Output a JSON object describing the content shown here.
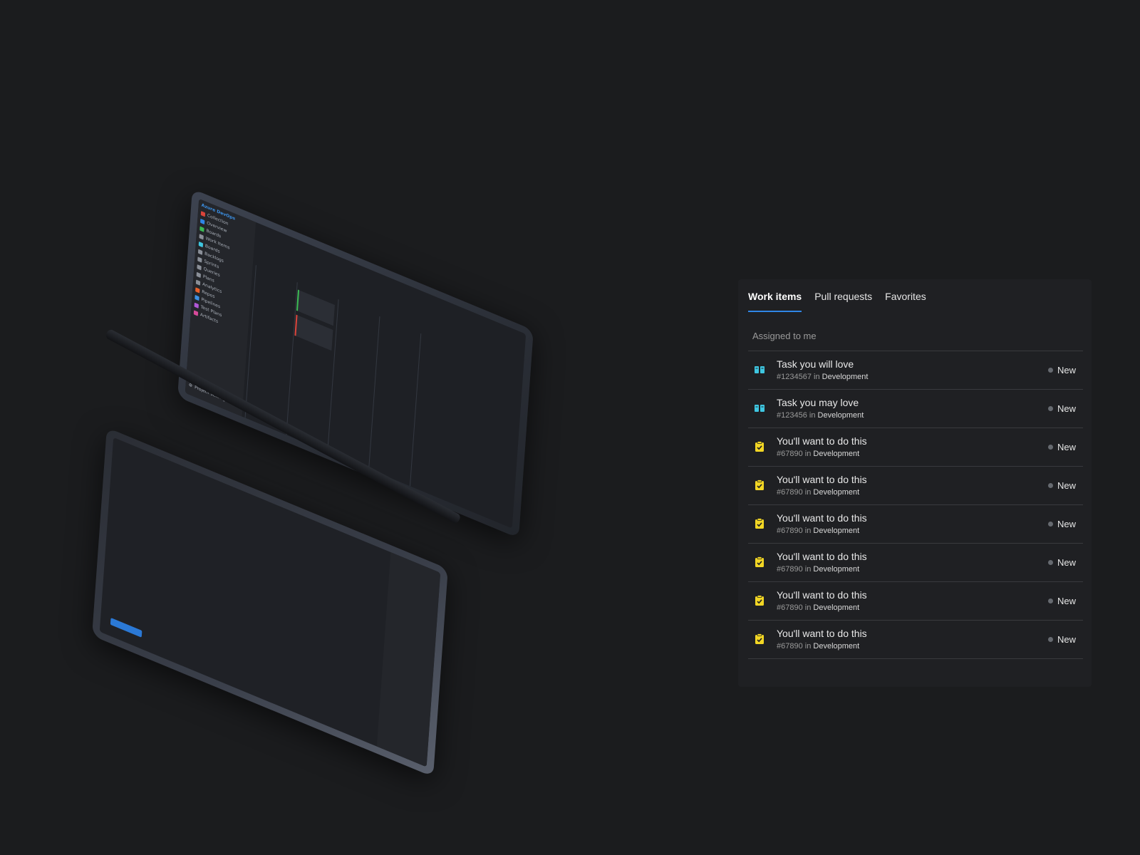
{
  "colors": {
    "background": "#1b1c1e",
    "panel": "#1f2023",
    "accent": "#2f86e6",
    "story_icon": "#3ec6e0",
    "task_icon": "#f2d624",
    "state_new": "#666a70"
  },
  "tabs": [
    {
      "label": "Work items",
      "active": true
    },
    {
      "label": "Pull requests",
      "active": false
    },
    {
      "label": "Favorites",
      "active": false
    }
  ],
  "section_label": "Assigned to me",
  "work_items": [
    {
      "icon": "book-icon",
      "title": "Task you will love",
      "id": "#1234567",
      "in_word": "in",
      "project": "Development",
      "state": "New"
    },
    {
      "icon": "book-icon",
      "title": "Task you may love",
      "id": "#123456",
      "in_word": "in",
      "project": "Development",
      "state": "New"
    },
    {
      "icon": "clipboard-check-icon",
      "title": "You'll want to do this",
      "id": "#67890",
      "in_word": "in",
      "project": "Development",
      "state": "New"
    },
    {
      "icon": "clipboard-check-icon",
      "title": "You'll want to do this",
      "id": "#67890",
      "in_word": "in",
      "project": "Development",
      "state": "New"
    },
    {
      "icon": "clipboard-check-icon",
      "title": "You'll want to do this",
      "id": "#67890",
      "in_word": "in",
      "project": "Development",
      "state": "New"
    },
    {
      "icon": "clipboard-check-icon",
      "title": "You'll want to do this",
      "id": "#67890",
      "in_word": "in",
      "project": "Development",
      "state": "New"
    },
    {
      "icon": "clipboard-check-icon",
      "title": "You'll want to do this",
      "id": "#67890",
      "in_word": "in",
      "project": "Development",
      "state": "New"
    },
    {
      "icon": "clipboard-check-icon",
      "title": "You'll want to do this",
      "id": "#67890",
      "in_word": "in",
      "project": "Development",
      "state": "New"
    }
  ],
  "device": {
    "brand": "Azure DevOps",
    "org": "Collection",
    "nav": [
      "Overview",
      "Boards",
      "Work Items",
      "Boards",
      "Backlogs",
      "Sprints",
      "Queries",
      "Plans",
      "Analytics",
      "Repos",
      "Pipelines",
      "Test Plans",
      "Artifacts"
    ],
    "footer": "Project settings"
  }
}
